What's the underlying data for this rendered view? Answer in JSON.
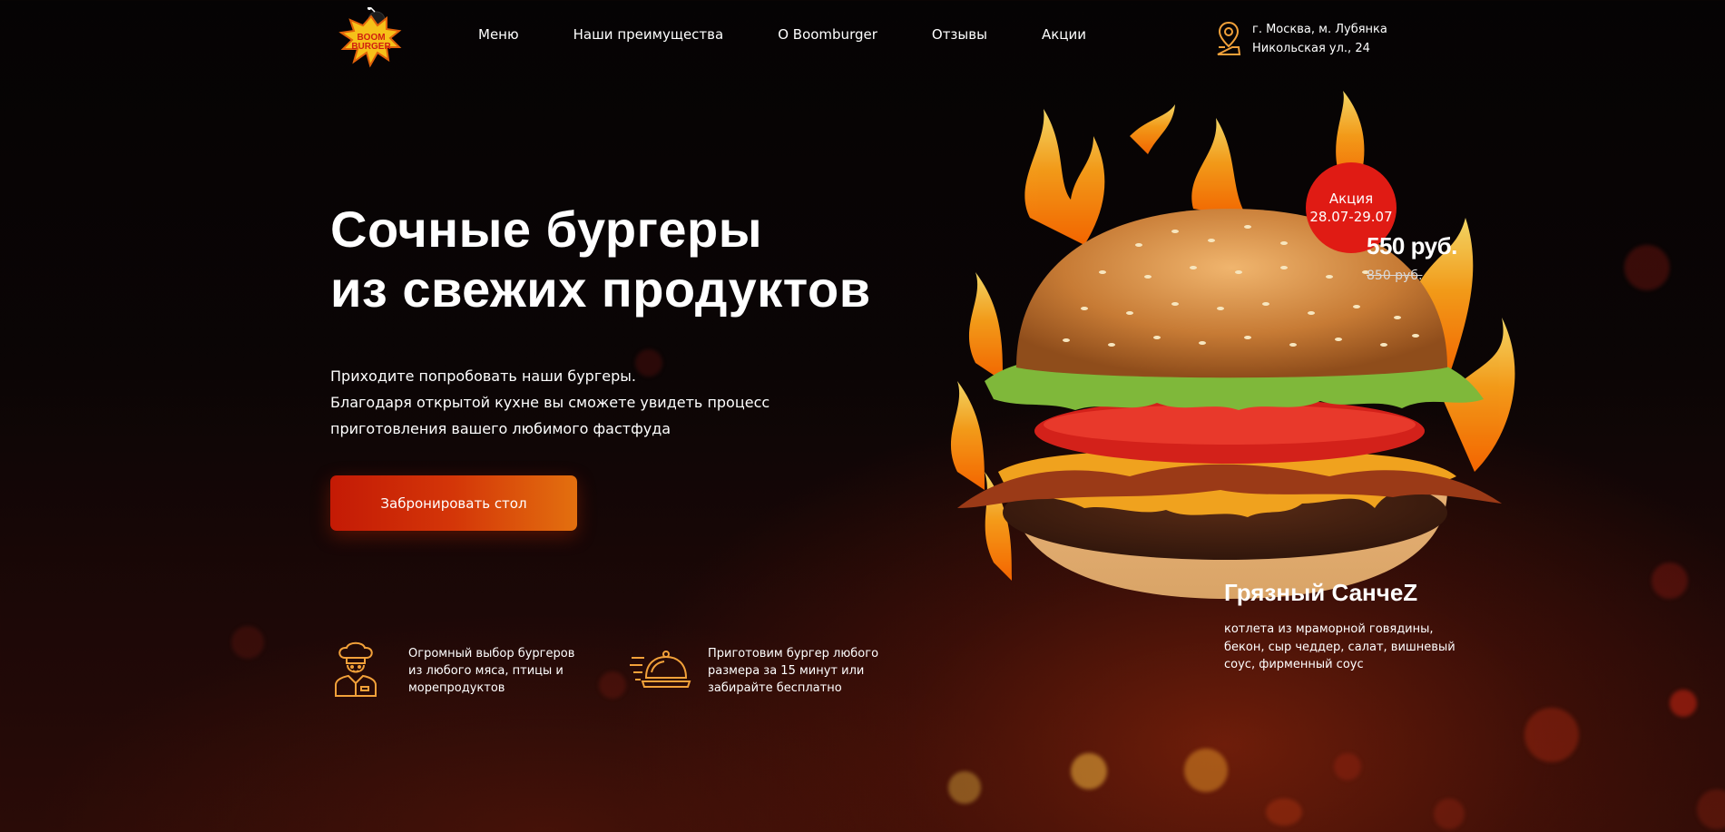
{
  "brand": {
    "logo_text_line1": "BOOM",
    "logo_text_line2": "BURGER"
  },
  "nav": {
    "items": [
      "Меню",
      "Наши преимущества",
      "О Boomburger",
      "Отзывы",
      "Акции"
    ]
  },
  "address": {
    "line1": "г. Москва, м. Лубянка",
    "line2": "Никольская ул., 24",
    "icon": "map-pin-icon"
  },
  "hero": {
    "title_line1": "Сочные бургеры",
    "title_line2": "из свежих продуктов",
    "sub_line1": "Приходите попробовать наши бургеры.",
    "sub_line2": "Благодаря открытой кухне вы сможете увидеть процесс",
    "sub_line3": "приготовления вашего любимого фастфуда",
    "cta_label": "Забронировать стол"
  },
  "features": [
    {
      "icon": "chef-icon",
      "line1": "Огромный выбор бургеров",
      "line2": "из любого мяса, птицы и",
      "line3": "морепродуктов"
    },
    {
      "icon": "cloche-icon",
      "line1": "Приготовим бургер любого",
      "line2": "размера за 15 минут или",
      "line3": "забирайте бесплатно"
    }
  ],
  "promo": {
    "badge_title": "Акция",
    "badge_dates": "28.07-29.07",
    "price_new": "550 руб.",
    "price_old": "850 руб.",
    "name": "Грязный СанчеZ",
    "desc": "котлета из мраморной говядины, бекон, сыр чеддер, салат, вишневый соус, фирменный соус"
  },
  "colors": {
    "accent_red": "#e01b14",
    "cta_start": "#c41a05",
    "cta_end": "#e3700f",
    "icon_orange": "#f2a13a"
  }
}
